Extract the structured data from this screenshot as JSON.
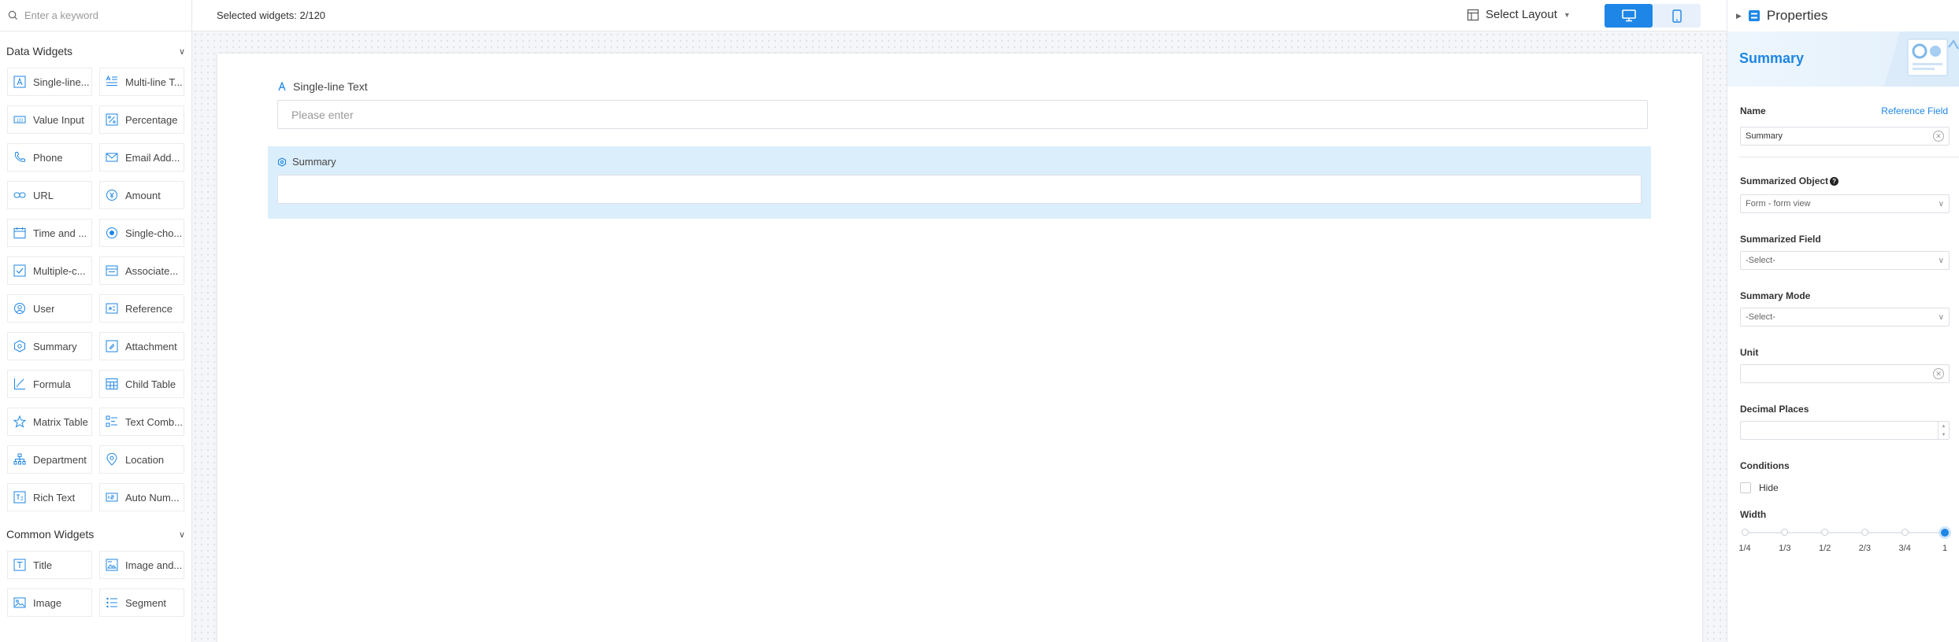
{
  "search": {
    "placeholder": "Enter a keyword"
  },
  "data_widgets": {
    "title": "Data Widgets",
    "items": [
      {
        "label": "Single-line...",
        "icon": "single-line-text-icon"
      },
      {
        "label": "Multi-line T...",
        "icon": "multi-line-text-icon"
      },
      {
        "label": "Value Input",
        "icon": "value-input-icon"
      },
      {
        "label": "Percentage",
        "icon": "percentage-icon"
      },
      {
        "label": "Phone",
        "icon": "phone-icon"
      },
      {
        "label": "Email Add...",
        "icon": "email-icon"
      },
      {
        "label": "URL",
        "icon": "link-icon"
      },
      {
        "label": "Amount",
        "icon": "amount-icon"
      },
      {
        "label": "Time and ...",
        "icon": "calendar-icon"
      },
      {
        "label": "Single-cho...",
        "icon": "radio-icon"
      },
      {
        "label": "Multiple-c...",
        "icon": "checkbox-icon"
      },
      {
        "label": "Associate...",
        "icon": "associate-icon"
      },
      {
        "label": "User",
        "icon": "user-icon"
      },
      {
        "label": "Reference",
        "icon": "reference-icon"
      },
      {
        "label": "Summary",
        "icon": "summary-icon"
      },
      {
        "label": "Attachment",
        "icon": "attachment-icon"
      },
      {
        "label": "Formula",
        "icon": "formula-icon"
      },
      {
        "label": "Child Table",
        "icon": "child-table-icon"
      },
      {
        "label": "Matrix Table",
        "icon": "matrix-table-icon"
      },
      {
        "label": "Text Comb...",
        "icon": "text-combination-icon"
      },
      {
        "label": "Department",
        "icon": "department-icon"
      },
      {
        "label": "Location",
        "icon": "location-icon"
      },
      {
        "label": "Rich Text",
        "icon": "rich-text-icon"
      },
      {
        "label": "Auto Num...",
        "icon": "auto-number-icon"
      }
    ]
  },
  "common_widgets": {
    "title": "Common Widgets",
    "items": [
      {
        "label": "Title",
        "icon": "title-icon"
      },
      {
        "label": "Image and...",
        "icon": "image-text-icon"
      },
      {
        "label": "Image",
        "icon": "image-icon"
      },
      {
        "label": "Segment",
        "icon": "segment-icon"
      }
    ]
  },
  "toolbar": {
    "selected_count": "Selected widgets: 2/120",
    "layout_label": "Select Layout"
  },
  "canvas": {
    "field1_label": "Single-line Text",
    "field1_placeholder": "Please enter",
    "field2_label": "Summary"
  },
  "properties": {
    "title": "Properties",
    "banner_title": "Summary",
    "name_label": "Name",
    "reference_link": "Reference Field",
    "name_value": "Summary",
    "summarized_object_label": "Summarized Object",
    "summarized_object_value": "Form - form view",
    "summarized_field_label": "Summarized Field",
    "summarized_field_value": "-Select-",
    "summary_mode_label": "Summary Mode",
    "summary_mode_value": "-Select-",
    "unit_label": "Unit",
    "unit_value": "",
    "decimal_label": "Decimal Places",
    "decimal_value": "",
    "conditions_label": "Conditions",
    "hide_label": "Hide",
    "width_label": "Width",
    "width_ticks": [
      "1/4",
      "1/3",
      "1/2",
      "2/3",
      "3/4",
      "1"
    ],
    "width_selected_index": 5
  },
  "colors": {
    "accent": "#1e86e6",
    "selected_bg": "#dbeefb"
  }
}
